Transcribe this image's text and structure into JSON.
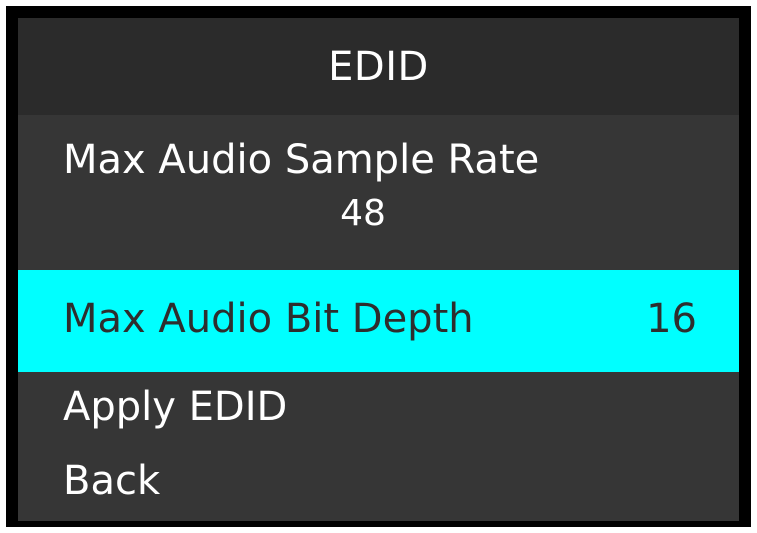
{
  "header": {
    "title": "EDID"
  },
  "menu": {
    "items": [
      {
        "label": "Max Audio Sample Rate",
        "value": "48"
      },
      {
        "label": "Max Audio Bit Depth",
        "value": "16",
        "selected": true
      },
      {
        "label": "Apply EDID"
      },
      {
        "label": "Back"
      }
    ]
  },
  "colors": {
    "selection_background": "#00ffff",
    "panel_background": "#363636",
    "header_background": "#2b2b2b",
    "text": "#ffffff",
    "selected_text": "#2e2e2e"
  }
}
